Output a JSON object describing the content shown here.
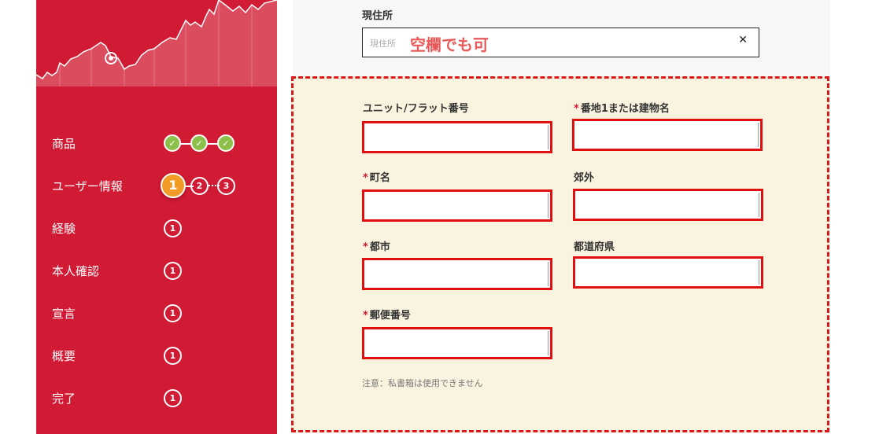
{
  "sidebar": {
    "steps": [
      {
        "label": "商品",
        "dots": [
          "",
          "",
          ""
        ]
      },
      {
        "label": "ユーザー情報",
        "dots": [
          "1",
          "2",
          "3"
        ]
      },
      {
        "label": "経験",
        "dots": [
          "1"
        ]
      },
      {
        "label": "本人確認",
        "dots": [
          "1"
        ]
      },
      {
        "label": "宣言",
        "dots": [
          "1"
        ]
      },
      {
        "label": "概要",
        "dots": [
          "1"
        ]
      },
      {
        "label": "完了",
        "dots": [
          "1"
        ]
      }
    ]
  },
  "address": {
    "label": "現住所",
    "placeholder": "現住所",
    "note": "空欄でも可",
    "clear_icon": "✕"
  },
  "form": {
    "required_mark": "*",
    "unit_label": "ユニット/フラット番号",
    "street_label": "番地1または建物名",
    "town_label": "町名",
    "suburb_label": "郊外",
    "city_label": "都市",
    "prefecture_label": "都道府県",
    "postal_label": "郵便番号",
    "note": "注意：私書箱は使用できません"
  },
  "colors": {
    "sidebar_bg": "#d11a33",
    "done": "#8dc04a",
    "current": "#f29b26",
    "error_border": "#e01010",
    "panel_bg": "#faf3df"
  }
}
